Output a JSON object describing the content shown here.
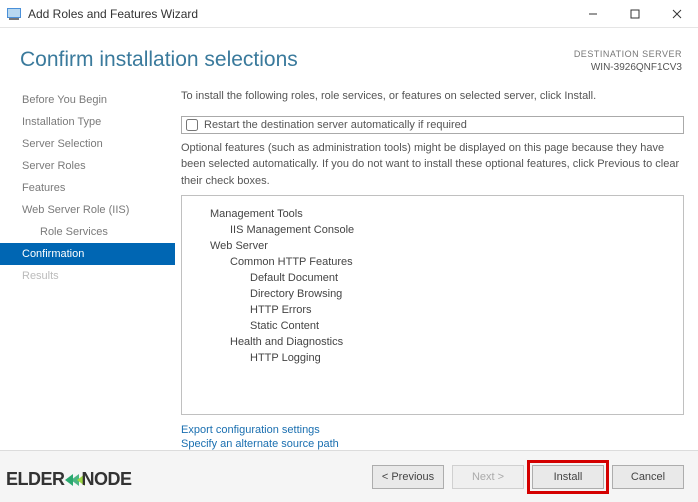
{
  "titlebar": {
    "title": "Add Roles and Features Wizard"
  },
  "header": {
    "page_title": "Confirm installation selections",
    "dest_label": "DESTINATION SERVER",
    "dest_server": "WIN-3926QNF1CV3"
  },
  "nav": {
    "items": [
      {
        "label": "Before You Begin",
        "active": false,
        "sub": false
      },
      {
        "label": "Installation Type",
        "active": false,
        "sub": false
      },
      {
        "label": "Server Selection",
        "active": false,
        "sub": false
      },
      {
        "label": "Server Roles",
        "active": false,
        "sub": false
      },
      {
        "label": "Features",
        "active": false,
        "sub": false
      },
      {
        "label": "Web Server Role (IIS)",
        "active": false,
        "sub": false
      },
      {
        "label": "Role Services",
        "active": false,
        "sub": true
      },
      {
        "label": "Confirmation",
        "active": true,
        "sub": false
      },
      {
        "label": "Results",
        "active": false,
        "sub": false,
        "disabled": true
      }
    ]
  },
  "main": {
    "instruction": "To install the following roles, role services, or features on selected server, click Install.",
    "restart_label": "Restart the destination server automatically if required",
    "optional_text": "Optional features (such as administration tools) might be displayed on this page because they have been selected automatically. If you do not want to install these optional features, click Previous to clear their check boxes.",
    "features": [
      {
        "text": "Management Tools",
        "indent": 1
      },
      {
        "text": "IIS Management Console",
        "indent": 2
      },
      {
        "text": "Web Server",
        "indent": 1
      },
      {
        "text": "Common HTTP Features",
        "indent": 2
      },
      {
        "text": "Default Document",
        "indent": 3
      },
      {
        "text": "Directory Browsing",
        "indent": 3
      },
      {
        "text": "HTTP Errors",
        "indent": 3
      },
      {
        "text": "Static Content",
        "indent": 3
      },
      {
        "text": "Health and Diagnostics",
        "indent": 2
      },
      {
        "text": "HTTP Logging",
        "indent": 3
      }
    ],
    "links": {
      "export": "Export configuration settings",
      "alt_path": "Specify an alternate source path"
    }
  },
  "footer": {
    "previous": "< Previous",
    "next": "Next >",
    "install": "Install",
    "cancel": "Cancel"
  },
  "watermark": {
    "brand_part1": "ELDER",
    "brand_part2": "NODE"
  }
}
